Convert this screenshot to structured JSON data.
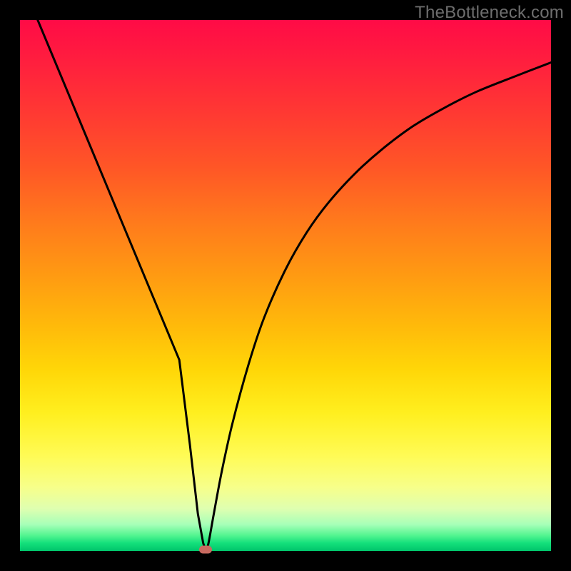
{
  "watermark": "TheBottleneck.com",
  "colors": {
    "frame": "#000000",
    "curve": "#000000",
    "marker": "#c86a60",
    "gradient_top": "#ff0b46",
    "gradient_bottom": "#00c46b"
  },
  "chart_data": {
    "type": "line",
    "title": "",
    "xlabel": "",
    "ylabel": "",
    "xlim": [
      0,
      100
    ],
    "ylim": [
      0,
      100
    ],
    "grid": false,
    "legend": false,
    "annotations": [
      "TheBottleneck.com"
    ],
    "series": [
      {
        "name": "left-branch",
        "x": [
          0,
          3,
          6,
          9,
          12,
          15,
          18,
          21,
          24,
          27,
          30,
          32,
          33.5,
          34.5,
          35
        ],
        "y": [
          108,
          100.8,
          93.6,
          86.4,
          79.2,
          72,
          64.8,
          57.6,
          50.4,
          43.2,
          36,
          20,
          7,
          1.5,
          0
        ]
      },
      {
        "name": "right-branch",
        "x": [
          35,
          35.5,
          36.5,
          38,
          40,
          43,
          46,
          50,
          54,
          58,
          63,
          68,
          74,
          80,
          86,
          93,
          100
        ],
        "y": [
          0,
          1.5,
          7,
          15,
          24,
          35,
          44,
          53,
          60,
          65.5,
          71,
          75.5,
          80,
          83.5,
          86.5,
          89.3,
          92
        ]
      }
    ],
    "minimum_point": {
      "x": 35,
      "y": 0
    }
  }
}
